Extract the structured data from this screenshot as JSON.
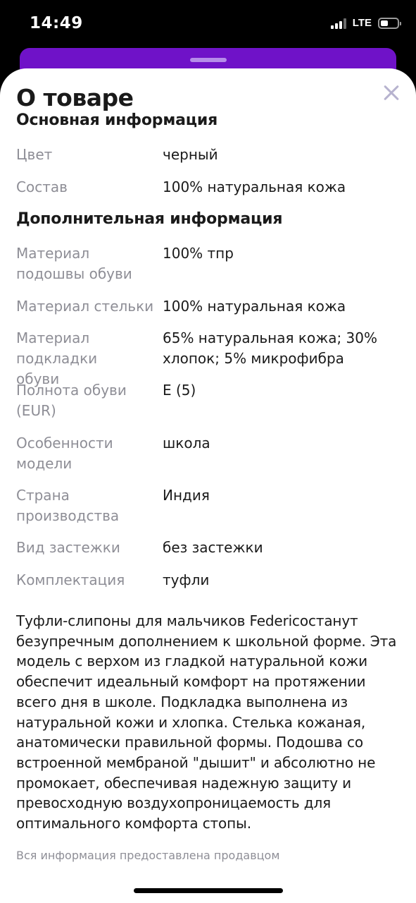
{
  "status_bar": {
    "time": "14:49",
    "network": "LTE",
    "signal_bars": 4,
    "signal_bars_filled": 3,
    "battery_level": 0.25
  },
  "sheet": {
    "title": "О товаре",
    "accent_color": "#6f12c8"
  },
  "main_info": {
    "heading": "Основная информация",
    "rows": [
      {
        "label": "Цвет",
        "value": "черный"
      },
      {
        "label": "Состав",
        "value": "100% натуральная кожа"
      }
    ]
  },
  "additional_info": {
    "heading": "Дополнительная информация",
    "rows": [
      {
        "label": "Материал подошвы обуви",
        "value": "100% тпр"
      },
      {
        "label": "Материал стельки",
        "value": "100% натуральная кожа"
      },
      {
        "label": "Материал подкладки обуви",
        "value": "65% натуральная кожа; 30% хлопок; 5% микрофибра"
      },
      {
        "label": "Полнота обуви (EUR)",
        "value": "E (5)"
      },
      {
        "label": "Особенности модели",
        "value": "школа"
      },
      {
        "label": "Страна производства",
        "value": "Индия"
      },
      {
        "label": "Вид застежки",
        "value": "без застежки"
      },
      {
        "label": "Комплектация",
        "value": "туфли"
      }
    ]
  },
  "description": "Туфли-слипоны для мальчиков Federicoстанут безупречным дополнением к школьной форме. Эта модель с верхом из гладкой натуральной кожи обеспечит идеальный комфорт на протяжении всего дня в школе. Подкладка выполнена из натуральной кожи и хлопка. Стелька кожаная, анатомически правильной формы. Подошва со встроенной мембраной \"дышит\" и абсолютно не промокает, обеспечивая надежную защиту и превосходную воздухопроницаемость для оптимального комфорта стопы.",
  "footnote": "Вся информация предоставлена продавцом"
}
